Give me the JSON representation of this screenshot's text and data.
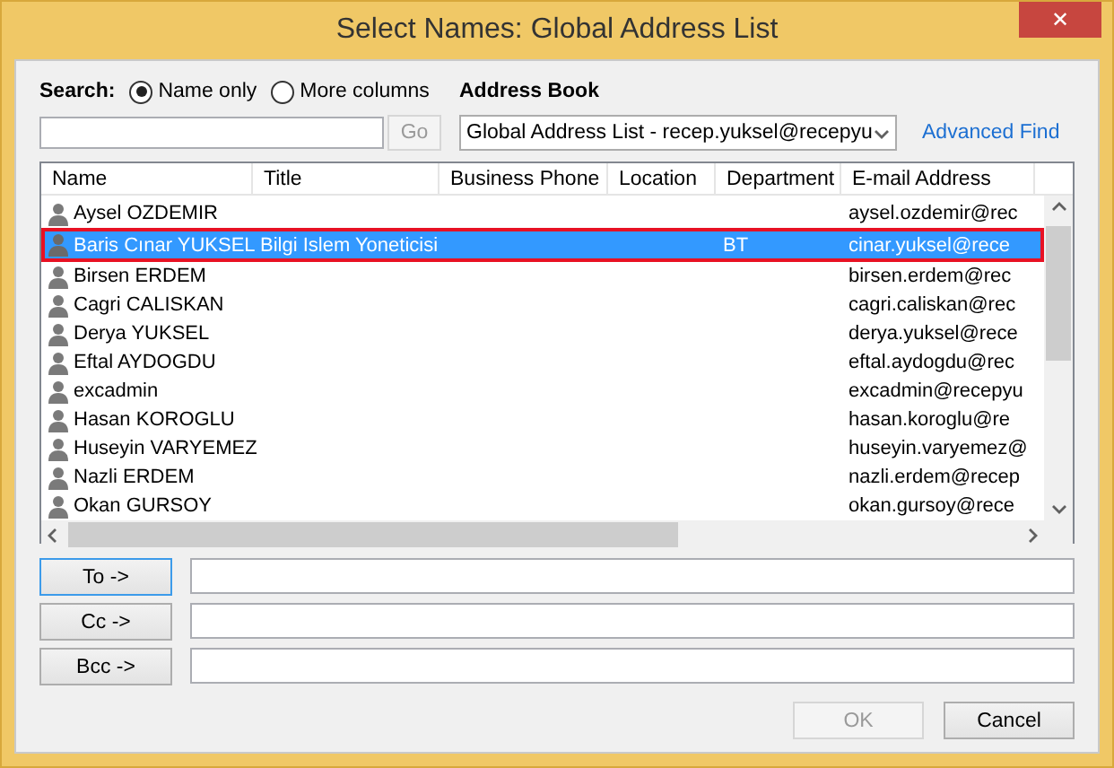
{
  "window": {
    "title": "Select Names: Global Address List",
    "close": "✕"
  },
  "search": {
    "label": "Search:",
    "options": [
      {
        "label": "Name only",
        "selected": true
      },
      {
        "label": "More columns",
        "selected": false
      }
    ],
    "go": "Go"
  },
  "address_book": {
    "label": "Address Book",
    "value": "Global Address List - recep.yuksel@recepyu",
    "advanced_find": "Advanced Find"
  },
  "table": {
    "columns": [
      "Name",
      "Title",
      "Business Phone",
      "Location",
      "Department",
      "E-mail Address"
    ],
    "rows": [
      {
        "cells": [
          "Aysel OZDEMIR",
          "",
          "",
          "",
          "",
          "aysel.ozdemir@rec"
        ],
        "selected": false,
        "outlined": false
      },
      {
        "cells": [
          "Baris Cınar YUKSEL",
          "Bilgi Islem Yoneticisi",
          "",
          "",
          "BT",
          "cinar.yuksel@rece"
        ],
        "selected": true,
        "outlined": true
      },
      {
        "cells": [
          "Birsen ERDEM",
          "",
          "",
          "",
          "",
          "birsen.erdem@rec"
        ],
        "selected": false,
        "outlined": false
      },
      {
        "cells": [
          "Cagri CALISKAN",
          "",
          "",
          "",
          "",
          "cagri.caliskan@rec"
        ],
        "selected": false,
        "outlined": false
      },
      {
        "cells": [
          "Derya YUKSEL",
          "",
          "",
          "",
          "",
          "derya.yuksel@rece"
        ],
        "selected": false,
        "outlined": false
      },
      {
        "cells": [
          "Eftal AYDOGDU",
          "",
          "",
          "",
          "",
          "eftal.aydogdu@rec"
        ],
        "selected": false,
        "outlined": false
      },
      {
        "cells": [
          "excadmin",
          "",
          "",
          "",
          "",
          "excadmin@recepyu"
        ],
        "selected": false,
        "outlined": false
      },
      {
        "cells": [
          "Hasan KOROGLU",
          "",
          "",
          "",
          "",
          "hasan.koroglu@re"
        ],
        "selected": false,
        "outlined": false
      },
      {
        "cells": [
          "Huseyin VARYEMEZ",
          "",
          "",
          "",
          "",
          "huseyin.varyemez@"
        ],
        "selected": false,
        "outlined": false
      },
      {
        "cells": [
          "Nazli ERDEM",
          "",
          "",
          "",
          "",
          "nazli.erdem@recep"
        ],
        "selected": false,
        "outlined": false
      },
      {
        "cells": [
          "Okan GURSOY",
          "",
          "",
          "",
          "",
          "okan.gursoy@rece"
        ],
        "selected": false,
        "outlined": false
      }
    ]
  },
  "recipients": [
    {
      "button": "To ->",
      "focused": true
    },
    {
      "button": "Cc ->",
      "focused": false
    },
    {
      "button": "Bcc ->",
      "focused": false
    }
  ],
  "buttons": [
    {
      "label": "OK",
      "disabled": true
    },
    {
      "label": "Cancel",
      "disabled": false
    }
  ]
}
